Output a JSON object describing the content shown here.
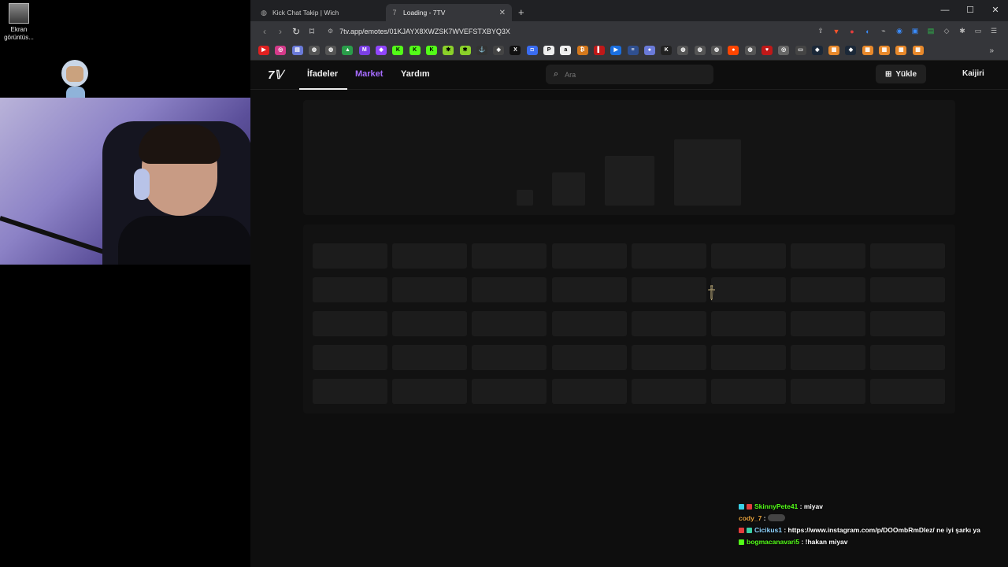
{
  "desktop": {
    "icon_label": "Ekran görüntüs..."
  },
  "browser": {
    "tabs": [
      {
        "title": "Kick Chat Takip | Wich",
        "icon": "globe-icon"
      },
      {
        "title": "Loading - 7TV",
        "icon": "7tv-icon"
      }
    ],
    "new_tab": "+",
    "window_controls": {
      "minimize": "—",
      "maximize": "☐",
      "close": "✕"
    },
    "url": "7tv.app/emotes/01KJAYX8XWZSK7WVEFSTXBYQ3X",
    "brave_badge": "1",
    "bookmarks_more": "»"
  },
  "site": {
    "logo": "7𝕍",
    "nav": {
      "emotes": "İfadeler",
      "market": "Market",
      "help": "Yardım"
    },
    "search_placeholder": "Ara",
    "upload_label": "Yükle",
    "username": "Kaijiri"
  },
  "chat": {
    "messages": [
      {
        "user": "SkinnyPete41",
        "text": "miyav"
      },
      {
        "user": "cody_7",
        "text": ""
      },
      {
        "user": "Cicikus1",
        "text": "https://www.instagram.com/p/DOOmbRmDlez/ ne iyi şarkı ya"
      },
      {
        "user": "bogmacanavari5",
        "text": "!hakan miyav"
      }
    ]
  }
}
